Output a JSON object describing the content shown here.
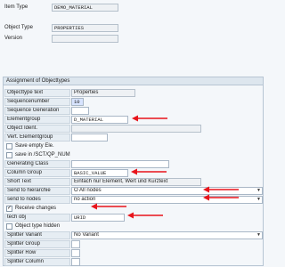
{
  "header": {
    "item_type_label": "Item Type",
    "item_type_value": "DEMO_MATERIAL",
    "object_type_label": "Object Type",
    "object_type_value": "PROPERTIES",
    "version_label": "Version",
    "version_value": ""
  },
  "group": {
    "title": "Assignment of Objecttypes",
    "rows": {
      "objecttype_text": {
        "label": "Objecttype text",
        "value": "Properties"
      },
      "sequencenumber": {
        "label": "Sequencenumber",
        "value": "10"
      },
      "sequence_generation": {
        "label": "Sequence Generation",
        "value": ""
      },
      "elementgroup": {
        "label": "Elementgroup",
        "value": "D_MATERIAL"
      },
      "object_ident": {
        "label": "Object Ident.",
        "value": ""
      },
      "vert_elementgroup": {
        "label": "Vert. Elementgroup",
        "value": ""
      },
      "save_empty": {
        "label": "Save empty Ele.",
        "checked": false
      },
      "save_in_sct": {
        "label": "save in /SCT/QP_NUM",
        "checked": false
      },
      "generating_class": {
        "label": "Generating Class",
        "value": ""
      },
      "column_group": {
        "label": "Column Group",
        "value": "BASIC_VALUE"
      },
      "short_text": {
        "label": "Short Text",
        "value": "Einfach nur Element, Wert und Kurztext"
      },
      "send_to_hierarchie": {
        "label": "Send to hierarchie",
        "value": "O All nodes"
      },
      "send_to_nodes": {
        "label": "send to nodes",
        "value": "no action"
      },
      "receive_changes": {
        "label": "Receive changes",
        "checked": true
      },
      "tech_obj": {
        "label": "tech obj",
        "value": "URID"
      },
      "object_type_hidden": {
        "label": "Object type hidden",
        "checked": false
      },
      "splitter_variant": {
        "label": "Splitter Variant",
        "value": "No Variant"
      },
      "splitter_group": {
        "label": "Splitter Group",
        "value": ""
      },
      "splitter_row": {
        "label": "Splitter Row",
        "value": ""
      },
      "splitter_column": {
        "label": "Splitter Column",
        "value": ""
      }
    }
  },
  "colors": {
    "arrow": "#e8141b",
    "group_header": "#dde6ee",
    "background": "#f4f7fa"
  }
}
